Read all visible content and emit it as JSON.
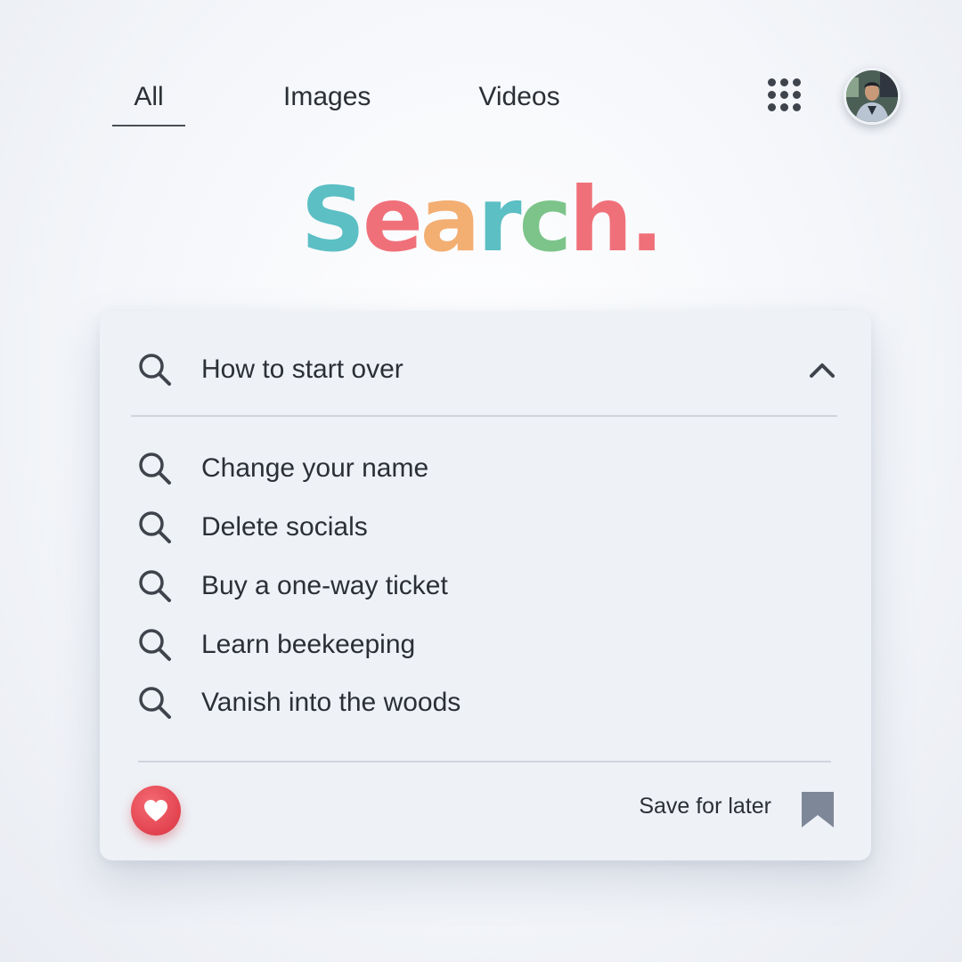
{
  "nav": {
    "tabs": [
      {
        "label": "All",
        "active": true
      },
      {
        "label": "Images",
        "active": false
      },
      {
        "label": "Videos",
        "active": false
      }
    ],
    "apps_icon": "grid-icon",
    "avatar_icon": "user-avatar"
  },
  "logo": {
    "letters": [
      {
        "char": "S",
        "color": "#5bbfc4"
      },
      {
        "char": "e",
        "color": "#f0707a"
      },
      {
        "char": "a",
        "color": "#f3ae72"
      },
      {
        "char": "r",
        "color": "#5bbfc4"
      },
      {
        "char": "c",
        "color": "#7cc48a"
      },
      {
        "char": "h",
        "color": "#f0707a"
      },
      {
        "char": ".",
        "color": "#f0707a"
      }
    ]
  },
  "search": {
    "query": "How to start over",
    "collapse_icon": "chevron-up-icon",
    "suggestions": [
      "Change your name",
      "Delete socials",
      "Buy a one-way ticket",
      "Learn beekeeping",
      "Vanish into the woods"
    ]
  },
  "footer": {
    "like_icon": "heart-icon",
    "save_label": "Save for later",
    "save_icon": "bookmark-icon"
  },
  "colors": {
    "heart": "#e2434f",
    "bookmark": "#7d8797",
    "text": "#2b2f36"
  }
}
